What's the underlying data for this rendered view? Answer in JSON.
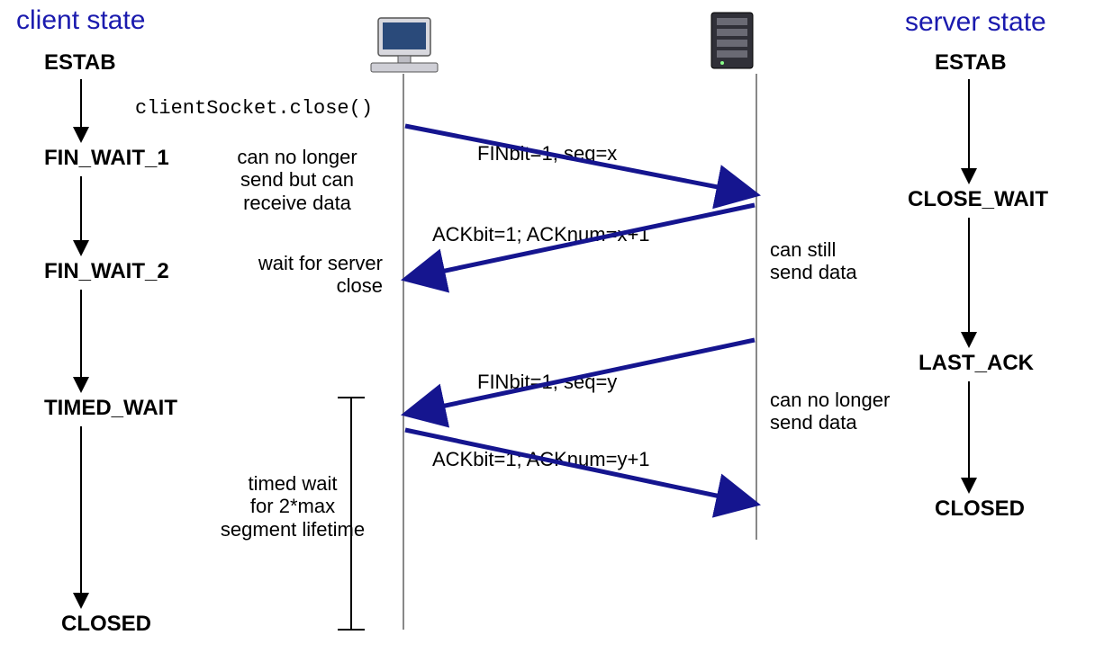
{
  "headings": {
    "client": "client state",
    "server": "server state"
  },
  "client_states": {
    "s0": "ESTAB",
    "s1": "FIN_WAIT_1",
    "s2": "FIN_WAIT_2",
    "s3": "TIMED_WAIT",
    "s4": "CLOSED"
  },
  "server_states": {
    "s0": "ESTAB",
    "s1": "CLOSE_WAIT",
    "s2": "LAST_ACK",
    "s3": "CLOSED"
  },
  "code": {
    "close_call": "clientSocket.close()"
  },
  "notes": {
    "client_fw1": "can no longer\nsend but can\nreceive data",
    "client_fw2": "wait for server\nclose",
    "timed_wait": "timed wait\nfor 2*max\nsegment lifetime",
    "server_cw": "can still\nsend data",
    "server_la": "can no longer\nsend data"
  },
  "messages": {
    "m1": "FINbit=1, seq=x",
    "m2": "ACKbit=1; ACKnum=x+1",
    "m3": "FINbit=1, seq=y",
    "m4": "ACKbit=1; ACKnum=y+1"
  }
}
